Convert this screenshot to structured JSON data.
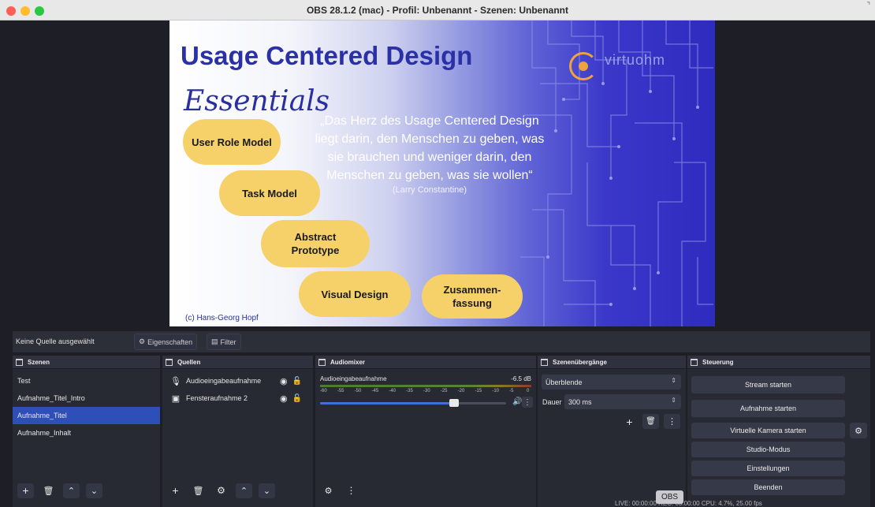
{
  "window": {
    "title": "OBS 28.1.2 (mac) - Profil: Unbenannt - Szenen: Unbenannt",
    "traffic_colors": [
      "#ff5f57",
      "#febc2e",
      "#28c840"
    ]
  },
  "slide": {
    "title": "Usage Centered Design",
    "subtitle": "Essentials",
    "logo_text": "virtuohm",
    "quote": "„Das Herz des Usage Centered Design liegt darin, den Menschen zu geben, was sie brauchen und weniger darin, den Menschen zu geben, was sie wollen“",
    "quote_author": "(Larry Constantine)",
    "pills": [
      "User Role Model",
      "Task Model",
      "Abstract Prototype",
      "Visual Design",
      "Zusammen-fassung"
    ],
    "copyright": "(c) Hans-Georg Hopf"
  },
  "status": {
    "no_source": "Keine Quelle ausgewählt",
    "properties": "Eigenschaften",
    "filter": "Filter"
  },
  "scenes": {
    "title": "Szenen",
    "items": [
      "Test",
      "Aufnahme_Titel_Intro",
      "Aufnahme_Titel",
      "Aufnahme_Inhalt"
    ],
    "selected": "Aufnahme_Titel"
  },
  "sources": {
    "title": "Quellen",
    "items": [
      {
        "label": "Audioeingabeaufnahme",
        "icon": "microphone-icon"
      },
      {
        "label": "Fensteraufnahme 2",
        "icon": "window-icon"
      }
    ]
  },
  "mixer": {
    "title": "Audiomixer",
    "channel": "Audioeingabeaufnahme",
    "db": "-6.5 dB",
    "scale": [
      "-60",
      "-55",
      "-50",
      "-45",
      "-40",
      "-35",
      "-30",
      "-25",
      "-20",
      "-15",
      "-10",
      "-5",
      "0"
    ],
    "volume_fraction": 0.72
  },
  "transitions": {
    "title": "Szenenübergänge",
    "transition": "Überblende",
    "duration_label": "Dauer",
    "duration_value": "300 ms"
  },
  "controls": {
    "title": "Steuerung",
    "buttons": [
      "Stream starten",
      "Aufnahme starten",
      "Virtuelle Kamera starten",
      "Studio-Modus",
      "Einstellungen",
      "Beenden"
    ]
  },
  "bottom": {
    "status_line": "LIVE: 00:00:00     REC: 00:00:00     CPU: 4.7%, 25.00 fps",
    "tooltip": "OBS"
  }
}
